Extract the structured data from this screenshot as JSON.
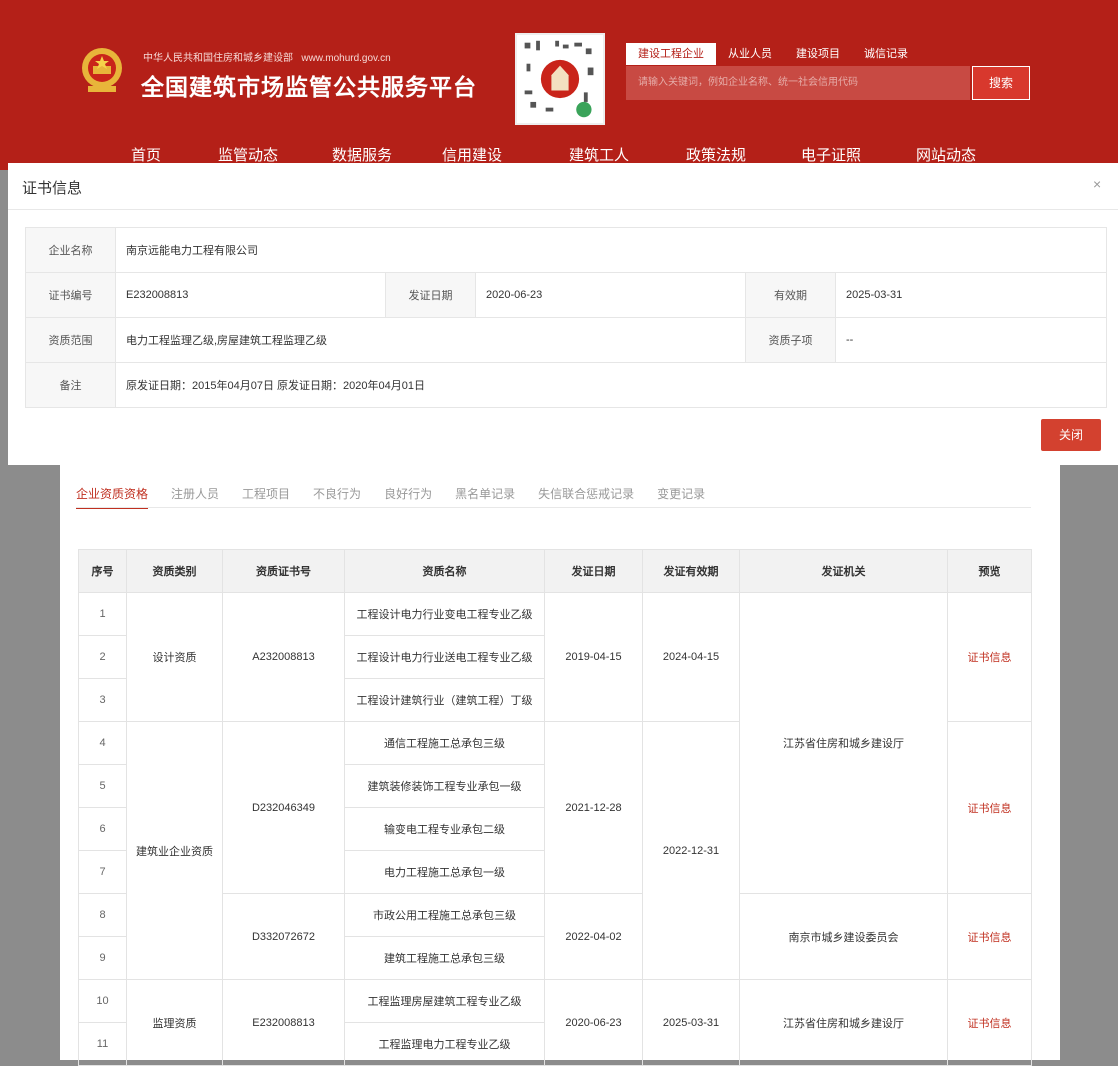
{
  "header": {
    "ministry": "中华人民共和国住房和城乡建设部",
    "url": "www.mohurd.gov.cn",
    "title": "全国建筑市场监管公共服务平台",
    "search_tabs": [
      "建设工程企业",
      "从业人员",
      "建设项目",
      "诚信记录"
    ],
    "search_placeholder": "请输入关键词，例如企业名称、统一社会信用代码",
    "search_button": "搜索",
    "nav": [
      "首页",
      "监管动态",
      "数据服务",
      "信用建设",
      "建筑工人",
      "政策法规",
      "电子证照",
      "网站动态"
    ]
  },
  "modal": {
    "title": "证书信息",
    "close_x": "×",
    "fields": {
      "company_label": "企业名称",
      "company": "南京远能电力工程有限公司",
      "cert_no_label": "证书编号",
      "cert_no": "E232008813",
      "issue_date_label": "发证日期",
      "issue_date": "2020-06-23",
      "valid_label": "有效期",
      "valid": "2025-03-31",
      "scope_label": "资质范围",
      "scope": "电力工程监理乙级,房屋建筑工程监理乙级",
      "sub_label": "资质子项",
      "sub": "--",
      "remark_label": "备注",
      "remark": "原发证日期：2015年04月07日 原发证日期：2020年04月01日"
    },
    "close_button": "关闭"
  },
  "tabs": [
    "企业资质资格",
    "注册人员",
    "工程项目",
    "不良行为",
    "良好行为",
    "黑名单记录",
    "失信联合惩戒记录",
    "变更记录"
  ],
  "table": {
    "headers": [
      "序号",
      "资质类别",
      "资质证书号",
      "资质名称",
      "发证日期",
      "发证有效期",
      "发证机关",
      "预览"
    ],
    "seq": [
      "1",
      "2",
      "3",
      "4",
      "5",
      "6",
      "7",
      "8",
      "9",
      "10",
      "11"
    ],
    "categories": [
      "设计资质",
      "建筑业企业资质",
      "监理资质"
    ],
    "cert_nos": [
      "A232008813",
      "D232046349",
      "D332072672",
      "E232008813"
    ],
    "names": [
      "工程设计电力行业变电工程专业乙级",
      "工程设计电力行业送电工程专业乙级",
      "工程设计建筑行业（建筑工程）丁级",
      "通信工程施工总承包三级",
      "建筑装修装饰工程专业承包一级",
      "输变电工程专业承包二级",
      "电力工程施工总承包一级",
      "市政公用工程施工总承包三级",
      "建筑工程施工总承包三级",
      "工程监理房屋建筑工程专业乙级",
      "工程监理电力工程专业乙级"
    ],
    "issue_dates": [
      "2019-04-15",
      "2021-12-28",
      "2022-04-02",
      "2020-06-23"
    ],
    "valid_dates": [
      "2024-04-15",
      "2022-12-31",
      "2025-03-31"
    ],
    "authorities": [
      "江苏省住房和城乡建设厅",
      "南京市城乡建设委员会",
      "江苏省住房和城乡建设厅"
    ],
    "preview": "证书信息"
  }
}
